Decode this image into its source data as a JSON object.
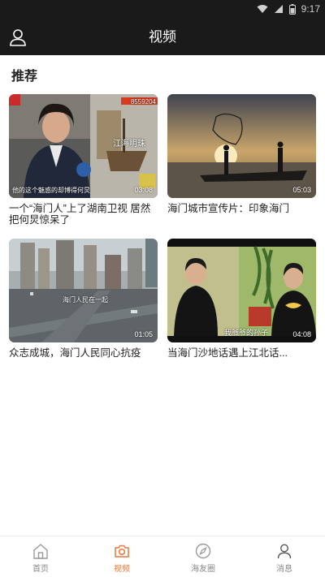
{
  "status_bar": {
    "time": "9:17"
  },
  "header": {
    "title": "视频"
  },
  "section": {
    "title": "推荐"
  },
  "videos": [
    {
      "caption": "一个“海门人”上了湖南卫视 居然把何炅惊呆了",
      "duration": "03:08",
      "overlay_top": "8559204",
      "overlay_sign": "江海明珠",
      "overlay_sub": "他的这个魅惑的却博得何炅"
    },
    {
      "caption": "海门城市宣传片：印象海门",
      "duration": "05:03"
    },
    {
      "caption": "众志成城，海门人民同心抗疫",
      "duration": "01:05",
      "overlay_sub": "海门人民在一起"
    },
    {
      "caption": "当海门沙地话遇上江北话...",
      "duration": "04:08",
      "overlay_sub": "我爷爷的孙子"
    }
  ],
  "tabbar": {
    "items": [
      {
        "label": "首页",
        "icon": "home-icon"
      },
      {
        "label": "视频",
        "icon": "camera-icon"
      },
      {
        "label": "海友圈",
        "icon": "compass-icon"
      },
      {
        "label": "消息",
        "icon": "person-icon"
      }
    ],
    "active_index": 1,
    "active_color": "#e8773a",
    "inactive_color": "#888888"
  },
  "colors": {
    "header_bg": "#1a1a1a",
    "accent": "#e8773a"
  }
}
